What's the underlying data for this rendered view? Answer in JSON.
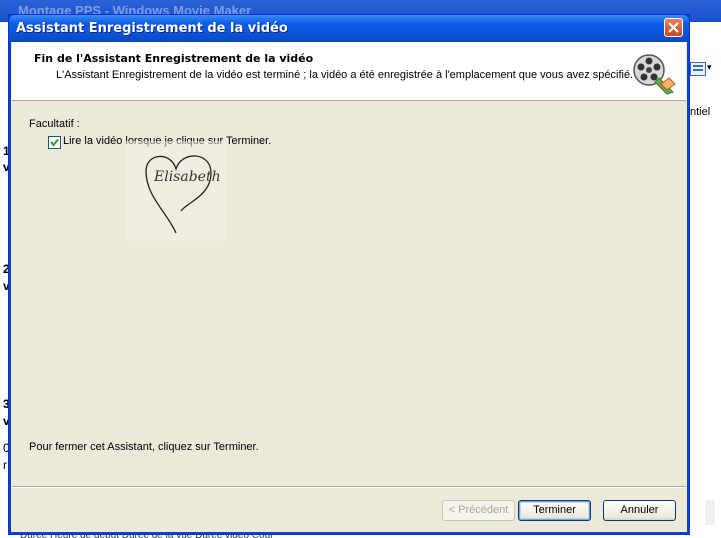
{
  "background_app": {
    "title": "Montage PPS - Windows Movie Maker",
    "partial_text": "ntiel",
    "side_items": [
      "1",
      "v",
      "2",
      "v",
      "3",
      "v",
      "0",
      "r"
    ],
    "bottom_strip": "Durée    Heure de début    Durée de la vue    Durée vidéo    Coul"
  },
  "dialog": {
    "title": "Assistant Enregistrement de la vidéo",
    "header_title": "Fin de l'Assistant Enregistrement de la vidéo",
    "header_subtitle": "L'Assistant Enregistrement de la vidéo est terminé ; la vidéo a été enregistrée à l'emplacement que vous avez spécifié.",
    "optional_label": "Facultatif :",
    "checkbox": {
      "label": "Lire la vidéo lorsque je clique sur Terminer.",
      "checked": true
    },
    "close_hint": "Pour fermer cet Assistant, cliquez sur Terminer.",
    "buttons": {
      "previous": "< Précédent",
      "finish": "Terminer",
      "cancel": "Annuler"
    },
    "watermark_signature": "Elisabeth"
  },
  "colors": {
    "titlebar": "#0a52d8",
    "dialog_face": "#ece9d8",
    "close_button": "#c44a22"
  },
  "icons": [
    "close-icon",
    "film-reel-icon",
    "checkmark-icon",
    "list-view-icon"
  ]
}
